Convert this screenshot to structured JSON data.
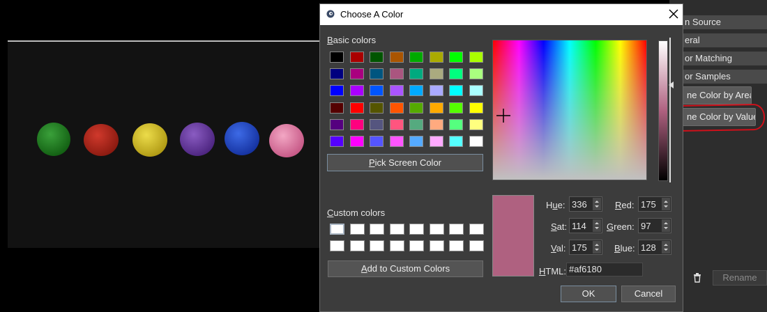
{
  "dialog": {
    "title": "Choose A Color",
    "basic_colors_label": "Basic colors",
    "basic_colors_underline": "B",
    "basic_colors_rest": "asic colors",
    "pick_screen_color": {
      "u": "P",
      "rest": "ick Screen Color"
    },
    "custom_colors_label": {
      "u": "C",
      "rest": "ustom colors"
    },
    "add_custom": {
      "u": "A",
      "rest": "dd to Custom Colors"
    },
    "hue": {
      "label_u": "u",
      "label_pre": "H",
      "label_post": "e:",
      "value": "336"
    },
    "sat": {
      "label_u": "S",
      "label_post": "at:",
      "value": "114"
    },
    "val": {
      "label_u": "V",
      "label_post": "al:",
      "value": "175"
    },
    "red": {
      "label_u": "R",
      "label_post": "ed:",
      "value": "175"
    },
    "green": {
      "label_u": "G",
      "label_post": "reen:",
      "value": "97"
    },
    "blue": {
      "label_u": "B",
      "label_post": "lue:",
      "value": "128"
    },
    "html": {
      "label_u": "H",
      "label_post": "TML:",
      "value": "#af6180"
    },
    "ok": "OK",
    "cancel": "Cancel",
    "current_color": "#af6180"
  },
  "basic_colors": [
    [
      "#000000",
      "#aa0000",
      "#005500",
      "#aa5500",
      "#00aa00",
      "#aaaa00",
      "#00ff00",
      "#aaff00"
    ],
    [
      "#00007f",
      "#aa007f",
      "#00557f",
      "#aa557f",
      "#00aa7f",
      "#aaaa7f",
      "#00ff7f",
      "#aaff7f"
    ],
    [
      "#0000ff",
      "#aa00ff",
      "#0055ff",
      "#aa55ff",
      "#00aaff",
      "#aaaaff",
      "#00ffff",
      "#aaffff"
    ],
    [
      "#550000",
      "#ff0000",
      "#555500",
      "#ff5500",
      "#55aa00",
      "#ffaa00",
      "#55ff00",
      "#ffff00"
    ],
    [
      "#55007f",
      "#ff007f",
      "#55557f",
      "#ff557f",
      "#55aa7f",
      "#ffaa7f",
      "#55ff7f",
      "#ffff7f"
    ],
    [
      "#5500ff",
      "#ff00ff",
      "#5555ff",
      "#ff55ff",
      "#55aaff",
      "#ffaaff",
      "#55ffff",
      "#ffffff"
    ]
  ],
  "side_panel": {
    "items": [
      "n Source",
      "eral",
      "or Matching",
      "or Samples"
    ],
    "define_by_area": "ne Color by Area",
    "define_by_value": "ne Color by Value",
    "rename": "Rename"
  },
  "candies": [
    "#1d7a1d",
    "#b02015",
    "#d4c025",
    "#6b3aa0",
    "#1f48c8",
    "#e67aa0"
  ]
}
